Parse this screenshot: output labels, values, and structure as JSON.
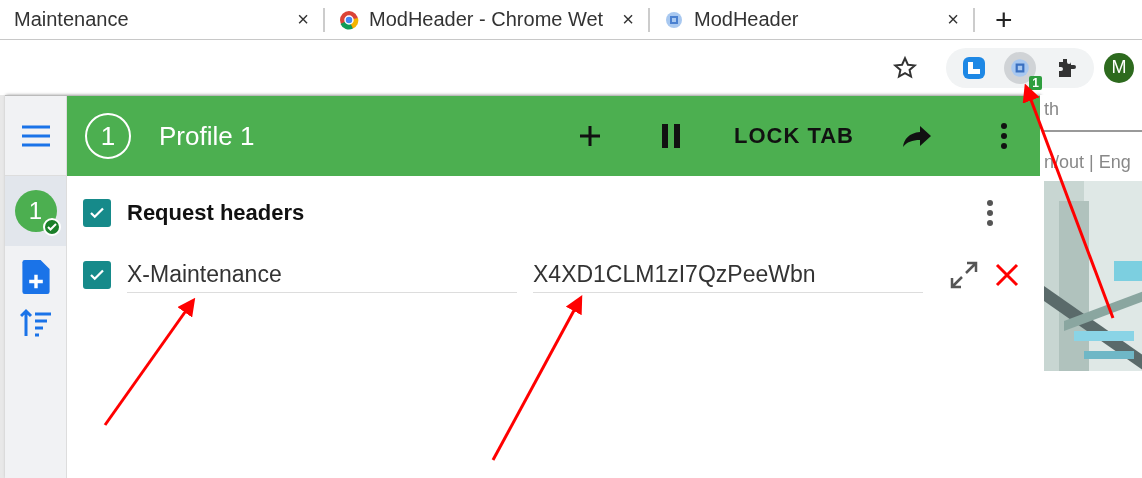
{
  "browser_tabs": [
    {
      "title": "Maintenance",
      "close": "×"
    },
    {
      "title": "ModHeader - Chrome Wet",
      "close": "×"
    },
    {
      "title": "ModHeader",
      "close": "×"
    }
  ],
  "new_tab": "+",
  "toolbar": {
    "extension_badge": "1",
    "avatar": "M"
  },
  "popup": {
    "sidebar": {
      "profiles": [
        {
          "label": "1",
          "selected": true,
          "active": true
        }
      ]
    },
    "header": {
      "number": "1",
      "profile_name": "Profile 1",
      "lock_tab": "LOCK TAB",
      "paused": false
    },
    "section": {
      "title": "Request headers",
      "checked": true,
      "headers": [
        {
          "name": "X-Maintenance",
          "value": "X4XD1CLM1zI7QzPeeWbn",
          "checked": true
        }
      ]
    }
  },
  "background_page": {
    "search_fragment": "th",
    "nav_fragment": "n/out | Eng"
  }
}
